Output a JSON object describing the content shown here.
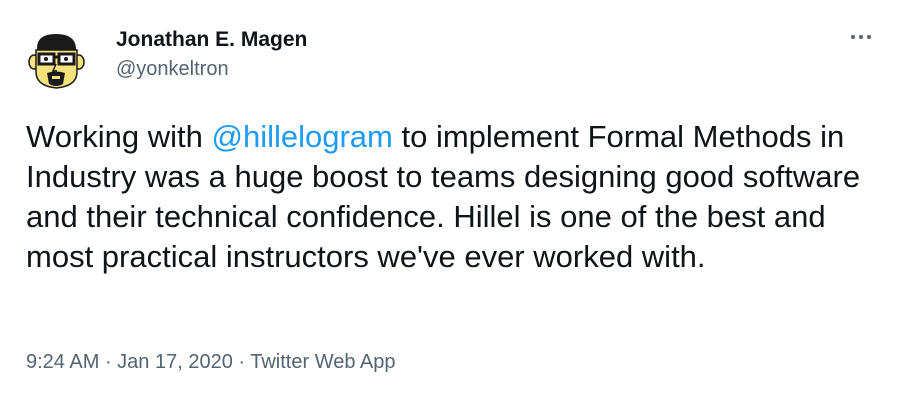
{
  "author": {
    "display_name": "Jonathan E. Magen",
    "handle": "@yonkeltron",
    "avatar_icon": "cartoon-face-with-glasses-avatar"
  },
  "menu": {
    "icon": "more-horizontal-icon"
  },
  "tweet": {
    "text_before": "Working with ",
    "mention": "@hillelogram",
    "text_after": " to implement Formal Methods in Industry was a huge boost to teams designing good software and their technical confidence. Hillel is one of the best and most practical instructors we've ever worked with."
  },
  "meta": {
    "time": "9:24 AM",
    "separator": " · ",
    "date": "Jan 17, 2020",
    "source": "Twitter Web App"
  },
  "colors": {
    "text": "#0f1419",
    "secondary": "#536471",
    "link": "#1d9bf0",
    "avatar_skin": "#f6e27a"
  }
}
